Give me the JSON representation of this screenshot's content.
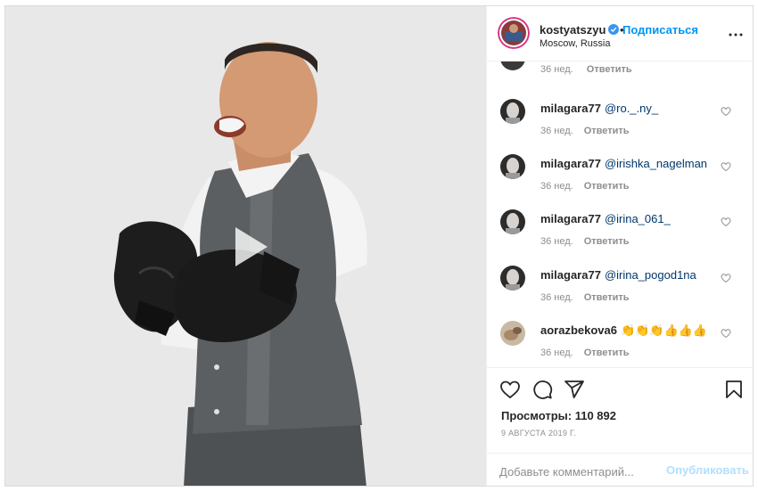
{
  "post": {
    "username": "kostyatszyu",
    "follow_label": "Подписаться",
    "location": "Moscow, Russia"
  },
  "comments_partial": {
    "time": "36 нед.",
    "reply_label": "Ответить"
  },
  "comments": [
    {
      "user": "milagara77",
      "mention": "@ro._.ny_",
      "time": "36 нед.",
      "reply_label": "Ответить"
    },
    {
      "user": "milagara77",
      "mention": "@irishka_nagelman",
      "time": "36 нед.",
      "reply_label": "Ответить"
    },
    {
      "user": "milagara77",
      "mention": "@irina_061_",
      "time": "36 нед.",
      "reply_label": "Ответить"
    },
    {
      "user": "milagara77",
      "mention": "@irina_pogod1na",
      "time": "36 нед.",
      "reply_label": "Ответить"
    },
    {
      "user": "aorazbekova6",
      "emoji": "👏👏👏👍👍👍",
      "time": "36 нед.",
      "reply_label": "Ответить"
    }
  ],
  "actions": {
    "views_label": "Просмотры:",
    "views_count": "110 892",
    "date": "9 АВГУСТА 2019 Г.",
    "comment_placeholder": "Добавьте комментарий...",
    "publish_label": "Опубликовать"
  },
  "icons": {
    "verified": "verified-badge-icon",
    "more": "more-options-icon",
    "like": "heart-icon",
    "comment": "comment-icon",
    "share": "share-icon",
    "save": "bookmark-icon",
    "play": "play-icon"
  },
  "colors": {
    "accent": "#0095f6",
    "mention": "#00376b",
    "muted": "#8e8e8e",
    "publish_disabled": "#b2dffc"
  }
}
